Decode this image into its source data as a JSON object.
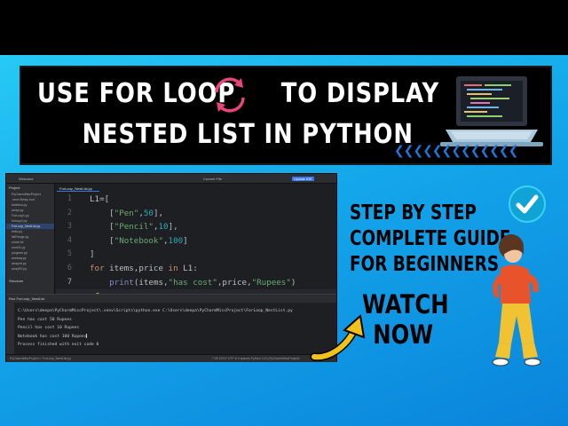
{
  "banner": {
    "line1": "USE FOR LOOP",
    "line1b": "TO DISPLAY",
    "line2": "NESTED LIST IN PYTHON"
  },
  "ide": {
    "topbar": {
      "project": "Welcome",
      "run_config": "Current File",
      "action": "Update IDE"
    },
    "project_panel": {
      "header": "Project",
      "items": [
        "PyCharmMiscProject",
        ".venv library root",
        "Addition.py",
        "arrayl.py",
        "ForLoop1.py",
        "forloop2.py",
        "ForLoop_NestList.py",
        "hello.py",
        "listRange.py",
        "numb.txt",
        "num01.py",
        "program.py",
        "workray.py",
        "arraymf.py",
        "arrayR2.py"
      ],
      "selected_index": 6
    },
    "structure_label": "Structure",
    "tab": "ForLoop_NestList.py",
    "line_numbers": [
      "1",
      "2",
      "3",
      "4",
      "5",
      "6",
      "7"
    ],
    "current_line": "7",
    "run_header": "Run  ForLoop_NestList",
    "output": [
      "C:\\Users\\deepa\\PyCharmMiscProject\\.venv\\Scripts\\python.exe C:\\Users\\deepa\\PyCharmMiscProject\\ForLoop_NestList.py",
      "Pen has cost 50 Rupees",
      "Pencil has cost 10 Rupees",
      "Notebook has cost 100 Rupees",
      "",
      "Process finished with exit code 0"
    ],
    "status": {
      "left": "PyCharmMiscProject > ForLoop_NestList.py",
      "right": "7:35  CRLF  UTF-8  4 spaces  Python 3.13 (PyCharmMiscProject)"
    }
  },
  "guide": {
    "line1": "STEP BY STEP",
    "line2": "COMPLETE GUIDE",
    "line3": "FOR BEGINNERS"
  },
  "watch": {
    "line1": "WATCH",
    "line2": "NOW"
  },
  "colors": {
    "sky": "#14a6ea",
    "banner_bg": "#000000",
    "loop_icon": "#e8457a",
    "check": "#0fa3d6",
    "arrow": "#f2c21a"
  }
}
